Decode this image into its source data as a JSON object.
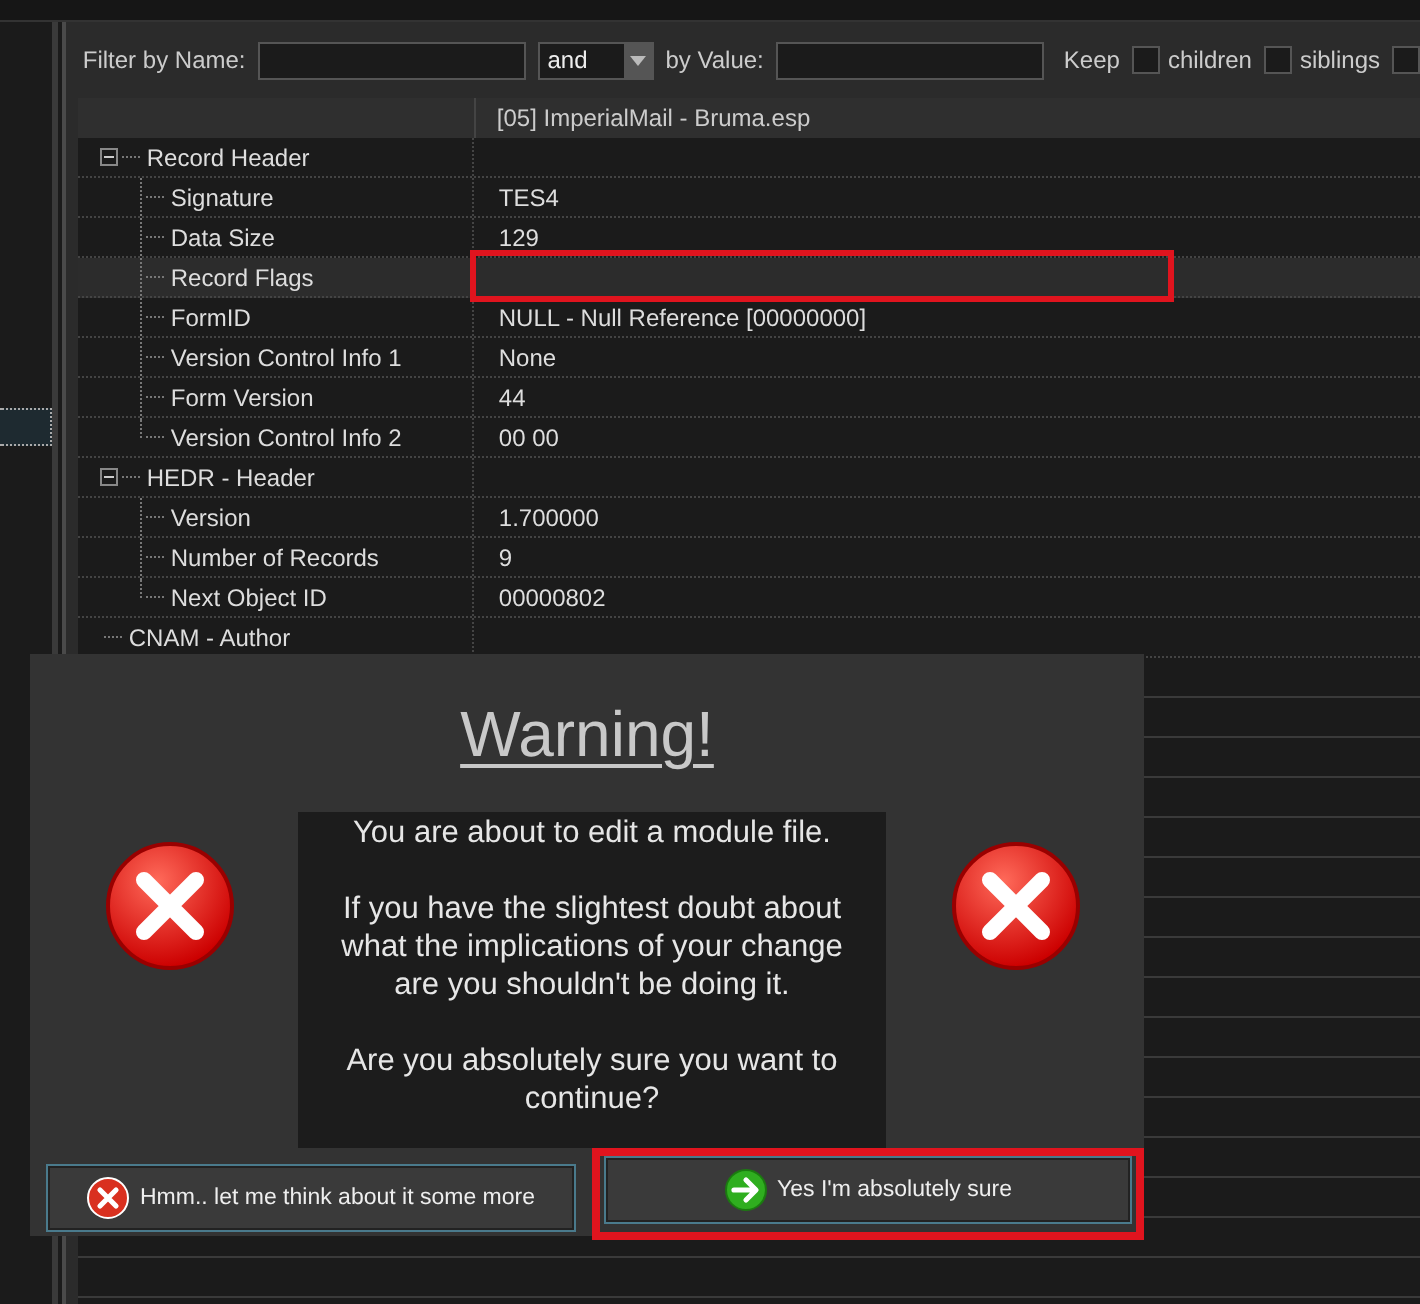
{
  "filter": {
    "name_label": "Filter by Name:",
    "operator": "and",
    "value_label": "by Value:",
    "keep_label": "Keep",
    "options": [
      {
        "label": "children",
        "checked": false
      },
      {
        "label": "siblings",
        "checked": false
      },
      {
        "checked": false
      }
    ]
  },
  "record_view": {
    "column_header": "[05] ImperialMail - Bruma.esp",
    "groups": [
      {
        "label": "Record Header",
        "expanded": true,
        "children": [
          {
            "label": "Signature",
            "value": "TES4",
            "selected": false,
            "annotated": false
          },
          {
            "label": "Data Size",
            "value": "129",
            "selected": false,
            "annotated": false
          },
          {
            "label": "Record Flags",
            "selected": true,
            "annotated": true
          },
          {
            "label": "FormID",
            "value": "NULL - Null Reference [00000000]",
            "selected": false,
            "annotated": false
          },
          {
            "label": "Version Control Info 1",
            "value": "None",
            "selected": false,
            "annotated": false
          },
          {
            "label": "Form Version",
            "value": "44",
            "selected": false,
            "annotated": false
          },
          {
            "label": "Version Control Info 2",
            "value": "00 00",
            "selected": false,
            "annotated": false
          }
        ]
      },
      {
        "label": "HEDR - Header",
        "expanded": true,
        "children": [
          {
            "label": "Version",
            "value": "1.700000",
            "selected": false,
            "annotated": false
          },
          {
            "label": "Number of Records",
            "value": "9",
            "selected": false,
            "annotated": false
          },
          {
            "label": "Next Object ID",
            "value": "00000802",
            "selected": false,
            "annotated": false
          }
        ]
      },
      {
        "label": "CNAM - Author"
      }
    ]
  },
  "dialog": {
    "title": "Warning!",
    "message": [
      "You are about to edit a module file.",
      "If you have the slightest doubt about what the implications of your change are you shouldn't be doing it.",
      "Are you absolutely sure you want to continue?"
    ],
    "buttons": [
      {
        "label": "Hmm.. let me think about it some more",
        "kind": "cancel",
        "annotated": false
      },
      {
        "label": "Yes I'm absolutely sure",
        "kind": "confirm",
        "annotated": true
      }
    ]
  }
}
